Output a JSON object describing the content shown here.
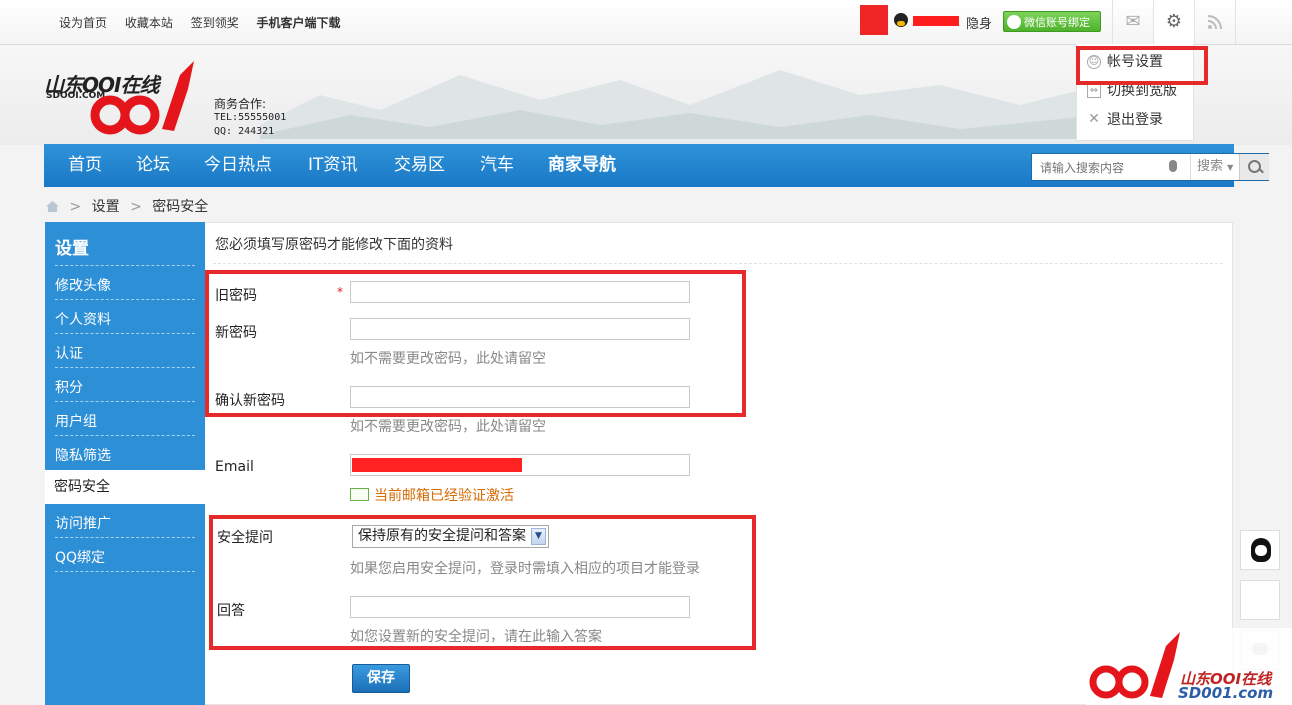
{
  "topbar": {
    "links": [
      "设为首页",
      "收藏本站",
      "签到领奖",
      "手机客户端下载"
    ],
    "status": "隐身",
    "wechat_bind": "微信账号绑定"
  },
  "icons": {
    "mail": "mail-icon",
    "settings": "gear-icon",
    "rss": "rss-icon"
  },
  "dropdown": {
    "items": [
      "帐号设置",
      "切换到宽版",
      "退出登录"
    ]
  },
  "brand": {
    "logo_text": "山东OOI在线",
    "logo_sub": "SDOOI.COM",
    "biz_title": "商务合作:",
    "biz_tel": "TEL:55555001",
    "biz_qq": "QQ:  244321"
  },
  "nav": {
    "items": [
      "首页",
      "论坛",
      "今日热点",
      "IT资讯",
      "交易区",
      "汽车",
      "商家导航"
    ],
    "search_placeholder": "请输入搜索内容",
    "search_select": "搜索"
  },
  "breadcrumb": {
    "items": [
      "设置",
      "密码安全"
    ],
    "separator": ">"
  },
  "sidebar": {
    "title": "设置",
    "items": [
      "修改头像",
      "个人资料",
      "认证",
      "积分",
      "用户组",
      "隐私筛选",
      "密码安全",
      "访问推广",
      "QQ绑定"
    ],
    "active": "密码安全"
  },
  "form": {
    "notice": "您必须填写原密码才能修改下面的资料",
    "old_password_label": "旧密码",
    "required_mark": "*",
    "new_password_label": "新密码",
    "new_password_hint": "如不需要更改密码，此处请留空",
    "confirm_password_label": "确认新密码",
    "confirm_password_hint": "如不需要更改密码，此处请留空",
    "email_label": "Email",
    "email_status": "当前邮箱已经验证激活",
    "security_question_label": "安全提问",
    "security_question_value": "保持原有的安全提问和答案",
    "security_question_hint": "如果您启用安全提问，登录时需填入相应的项目才能登录",
    "answer_label": "回答",
    "answer_hint": "如您设置新的安全提问，请在此输入答案",
    "save_label": "保存"
  },
  "watermark": {
    "line1": "山东OOI在线",
    "line2": "SD001.com"
  },
  "colors": {
    "nav_blue": "#2389d4",
    "sidebar_blue": "#2d8fd6",
    "highlight_red": "#e62a2a",
    "hint_gray": "#888888",
    "verified_orange": "#d86a00"
  }
}
